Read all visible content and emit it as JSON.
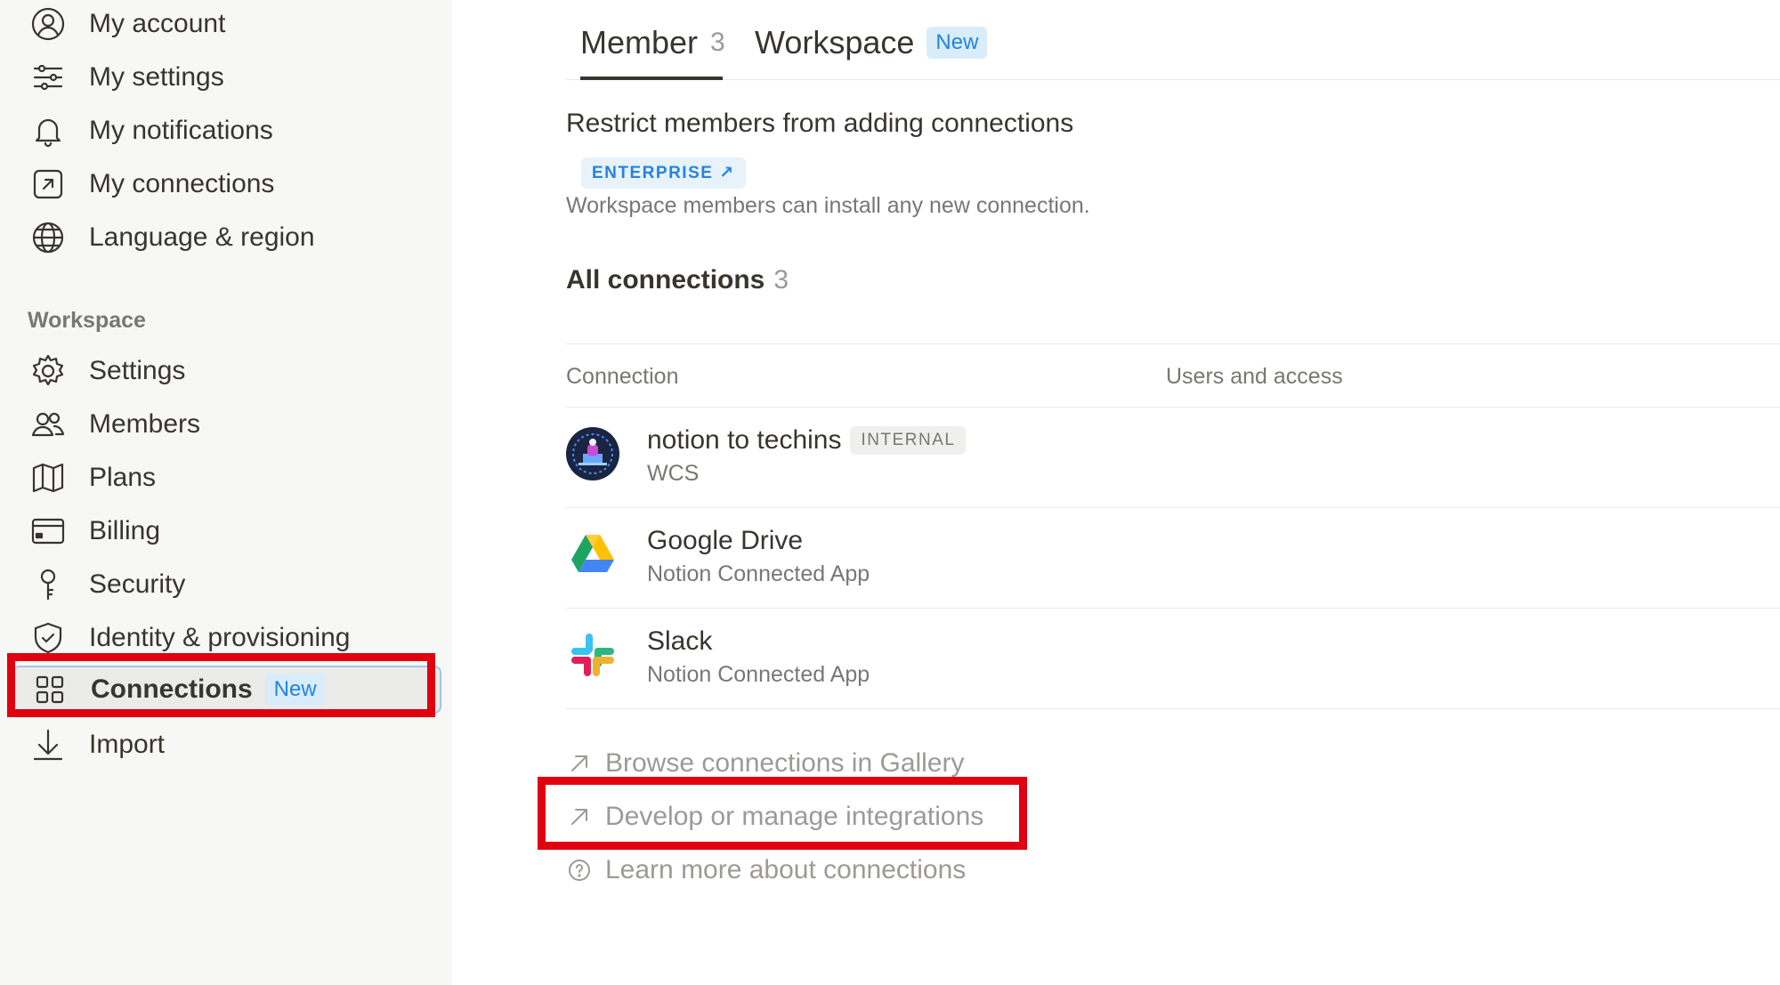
{
  "sidebar": {
    "items": [
      {
        "label": "My account",
        "icon": "user-circle-icon"
      },
      {
        "label": "My settings",
        "icon": "sliders-icon"
      },
      {
        "label": "My notifications",
        "icon": "bell-icon"
      },
      {
        "label": "My connections",
        "icon": "arrow-square-icon"
      },
      {
        "label": "Language & region",
        "icon": "globe-icon"
      }
    ],
    "section_label": "Workspace",
    "workspace_items": [
      {
        "label": "Settings",
        "icon": "gear-icon"
      },
      {
        "label": "Members",
        "icon": "people-icon"
      },
      {
        "label": "Plans",
        "icon": "map-icon"
      },
      {
        "label": "Billing",
        "icon": "credit-card-icon"
      },
      {
        "label": "Security",
        "icon": "key-icon"
      },
      {
        "label": "Identity & provisioning",
        "icon": "shield-check-icon"
      },
      {
        "label": "Connections",
        "icon": "grid-icon",
        "badge": "New",
        "active": true
      },
      {
        "label": "Import",
        "icon": "download-icon"
      }
    ]
  },
  "tabs": [
    {
      "label": "Member",
      "count": "3",
      "active": true
    },
    {
      "label": "Workspace",
      "badge": "New"
    }
  ],
  "restrict": {
    "title": "Restrict members from adding connections",
    "badge": "ENTERPRISE ↗",
    "description": "Workspace members can install any new connection."
  },
  "all_connections": {
    "title": "All connections",
    "count": "3"
  },
  "table": {
    "columns": [
      "Connection",
      "Users and access"
    ],
    "rows": [
      {
        "name": "notion to techins",
        "badge": "INTERNAL",
        "sub": "WCS",
        "icon": "techins-logo-icon"
      },
      {
        "name": "Google Drive",
        "sub": "Notion Connected App",
        "icon": "google-drive-icon"
      },
      {
        "name": "Slack",
        "sub": "Notion Connected App",
        "icon": "slack-icon"
      }
    ]
  },
  "links": [
    {
      "label": "Browse connections in Gallery",
      "icon": "arrow-up-right-icon"
    },
    {
      "label": "Develop or manage integrations",
      "icon": "arrow-up-right-icon"
    },
    {
      "label": "Learn more about connections",
      "icon": "question-circle-icon"
    }
  ],
  "colors": {
    "accent": "#2383e2",
    "highlight": "#e0000f",
    "sidebar_bg": "#f7f7f5"
  }
}
